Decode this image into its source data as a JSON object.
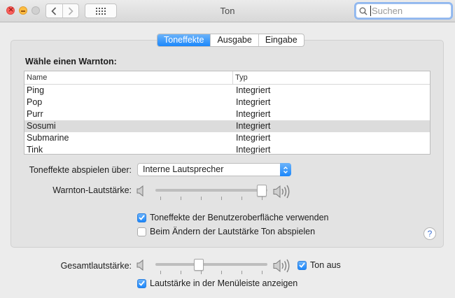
{
  "window": {
    "title": "Ton"
  },
  "search": {
    "placeholder": "Suchen"
  },
  "tabs": [
    {
      "label": "Toneffekte",
      "active": true
    },
    {
      "label": "Ausgabe",
      "active": false
    },
    {
      "label": "Eingabe",
      "active": false
    }
  ],
  "alert": {
    "title": "Wähle einen Warnton:",
    "columns": {
      "name": "Name",
      "type": "Typ"
    },
    "rows": [
      {
        "name": "Ping",
        "type": "Integriert"
      },
      {
        "name": "Pop",
        "type": "Integriert"
      },
      {
        "name": "Purr",
        "type": "Integriert"
      },
      {
        "name": "Sosumi",
        "type": "Integriert"
      },
      {
        "name": "Submarine",
        "type": "Integriert"
      },
      {
        "name": "Tink",
        "type": "Integriert"
      }
    ],
    "selected": "Sosumi"
  },
  "output": {
    "label": "Toneffekte abspielen über:",
    "selected": "Interne Lautsprecher"
  },
  "alert_volume": {
    "label": "Warnton-Lautstärke:",
    "value": 0.98
  },
  "checkboxes": {
    "ui_effects": {
      "label": "Toneffekte der Benutzeroberfläche verwenden",
      "checked": true
    },
    "volume_feedback": {
      "label": "Beim Ändern der Lautstärke Ton abspielen",
      "checked": false
    }
  },
  "help": {
    "label": "?"
  },
  "main_volume": {
    "label": "Gesamtlautstärke:",
    "value": 0.4,
    "mute": {
      "label": "Ton aus",
      "checked": true
    }
  },
  "menubar": {
    "label": "Lautstärke in der Menüleiste anzeigen",
    "checked": true
  },
  "colors": {
    "accent": "#1b87fb",
    "selected_row": "#dcdcdc"
  }
}
